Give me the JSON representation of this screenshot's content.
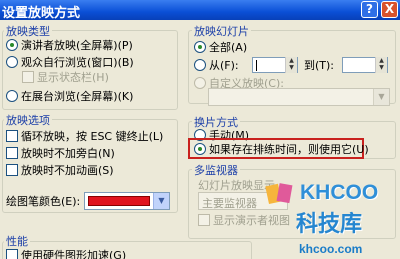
{
  "window": {
    "title": "设置放映方式",
    "help_symbol": "?",
    "close_symbol": "X"
  },
  "show_type": {
    "label": "放映类型",
    "options": [
      "演讲者放映(全屏幕)(P)",
      "观众自行浏览(窗口)(B)",
      "在展台浏览(全屏幕)(K)"
    ],
    "selected": "演讲者放映(全屏幕)(P)",
    "show_status_bar": "显示状态栏(H)"
  },
  "show_options": {
    "label": "放映选项",
    "loop": "循环放映，按 ESC 键终止(L)",
    "no_narration": "放映时不加旁白(N)",
    "no_animation": "放映时不加动画(S)",
    "pen_color_label": "绘图笔颜色(E):",
    "pen_color": "#e0141e"
  },
  "show_slides": {
    "label": "放映幻灯片",
    "all": "全部(A)",
    "from": "从(F):",
    "to": "到(T):",
    "custom": "自定义放映(C):",
    "selected": "全部(A)"
  },
  "advance": {
    "label": "换片方式",
    "manual": "手动(M)",
    "timings": "如果存在排练时间，则使用它(U)",
    "selected": "如果存在排练时间，则使用它(U)"
  },
  "multi_monitor": {
    "label": "多监视器",
    "display_label": "幻灯片放映显示",
    "display_value": "主要监视器",
    "presenter_view": "显示演示者视图"
  },
  "performance": {
    "label": "性能",
    "hardware_accel": "使用硬件图形加速(G)"
  },
  "watermark": {
    "brand": "KHCOO",
    "cn": "科技库",
    "url": "khcoo.com"
  },
  "colors": {
    "title_bar": "#0a4fd6",
    "group_label": "#1c3fa8",
    "highlight": "#c9211e",
    "watermark": "#2f8fd8"
  }
}
